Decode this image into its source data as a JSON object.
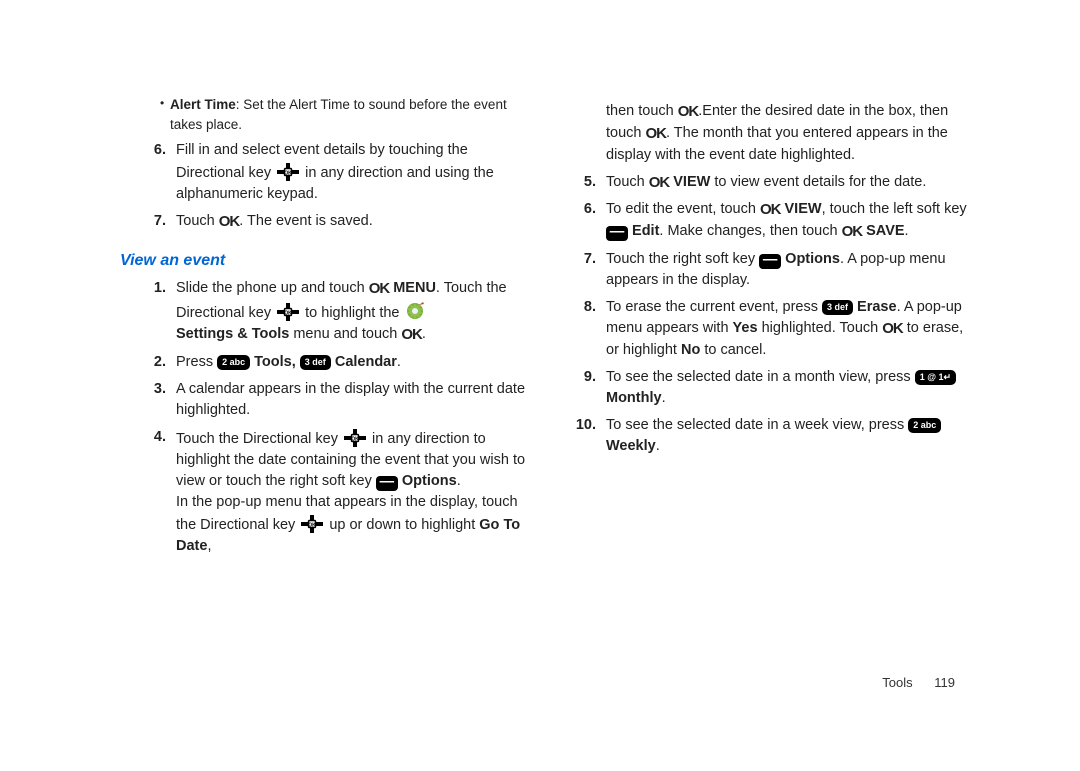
{
  "left": {
    "bullet": {
      "lead": "Alert Time",
      "rest": ": Set the Alert Time to sound before the event takes place."
    },
    "i6a": "Fill in and select event details by touching the Directional key ",
    "i6b": " in any direction and using the alphanumeric keypad.",
    "i7a": "Touch ",
    "i7b": ". The event is saved.",
    "section": "View an event",
    "v1a": "Slide the phone up and touch ",
    "v1b": " MENU",
    "v1c": ". Touch the Directional key ",
    "v1d": " to highlight the ",
    "v1e": "Settings & Tools",
    "v1f": " menu and touch ",
    "v1g": ".",
    "v2a": "Press ",
    "v2tools": "  Tools, ",
    "v2cal": "  Calendar",
    "v2end": ".",
    "v3": "A calendar appears in the display with the current date highlighted.",
    "v4a": "Touch the Directional key ",
    "v4b": " in any direction to highlight the date containing the event that you wish to view or touch the right soft key ",
    "v4opt": "  Options",
    "v4c": ".",
    "v4d": "In the pop-up menu that appears in the display, touch the Directional key ",
    "v4e": " up or down to highlight ",
    "v4f": "Go To Date",
    "v4g": ","
  },
  "right": {
    "r0a": "then touch ",
    "r0b": ".Enter the desired date in the box, then touch ",
    "r0c": ". The month that you entered appears in the display with the event date highlighted.",
    "r5a": "Touch ",
    "r5b": " VIEW",
    "r5c": " to view event details for the date.",
    "r6a": "To edit the event, touch ",
    "r6b": " VIEW",
    "r6c": ", touch the left soft key ",
    "r6edit": " Edit",
    "r6d": ". Make changes, then touch ",
    "r6save": " SAVE",
    "r6e": ".",
    "r7a": "Touch the right soft key ",
    "r7opt": "  Options",
    "r7b": ". A pop-up menu appears in the display.",
    "r8a": "To erase the current event, press ",
    "r8erase": "  Erase",
    "r8b": ". A pop-up menu appears with ",
    "r8yes": "Yes",
    "r8c": " highlighted. Touch ",
    "r8d": " to erase, or highlight ",
    "r8no": "No",
    "r8e": " to cancel.",
    "r9a": "To see the selected date in a month view, press ",
    "r9m": "Monthly",
    "r9b": ".",
    "r10a": "To see the selected date in a week view, press ",
    "r10w": "Weekly",
    "r10b": "."
  },
  "keys": {
    "ok": "OK",
    "k2": "2 abc",
    "k3": "3 def",
    "k1": "1 @ 1↵",
    "dash": "—"
  },
  "footer": {
    "section": "Tools",
    "page": "119"
  }
}
